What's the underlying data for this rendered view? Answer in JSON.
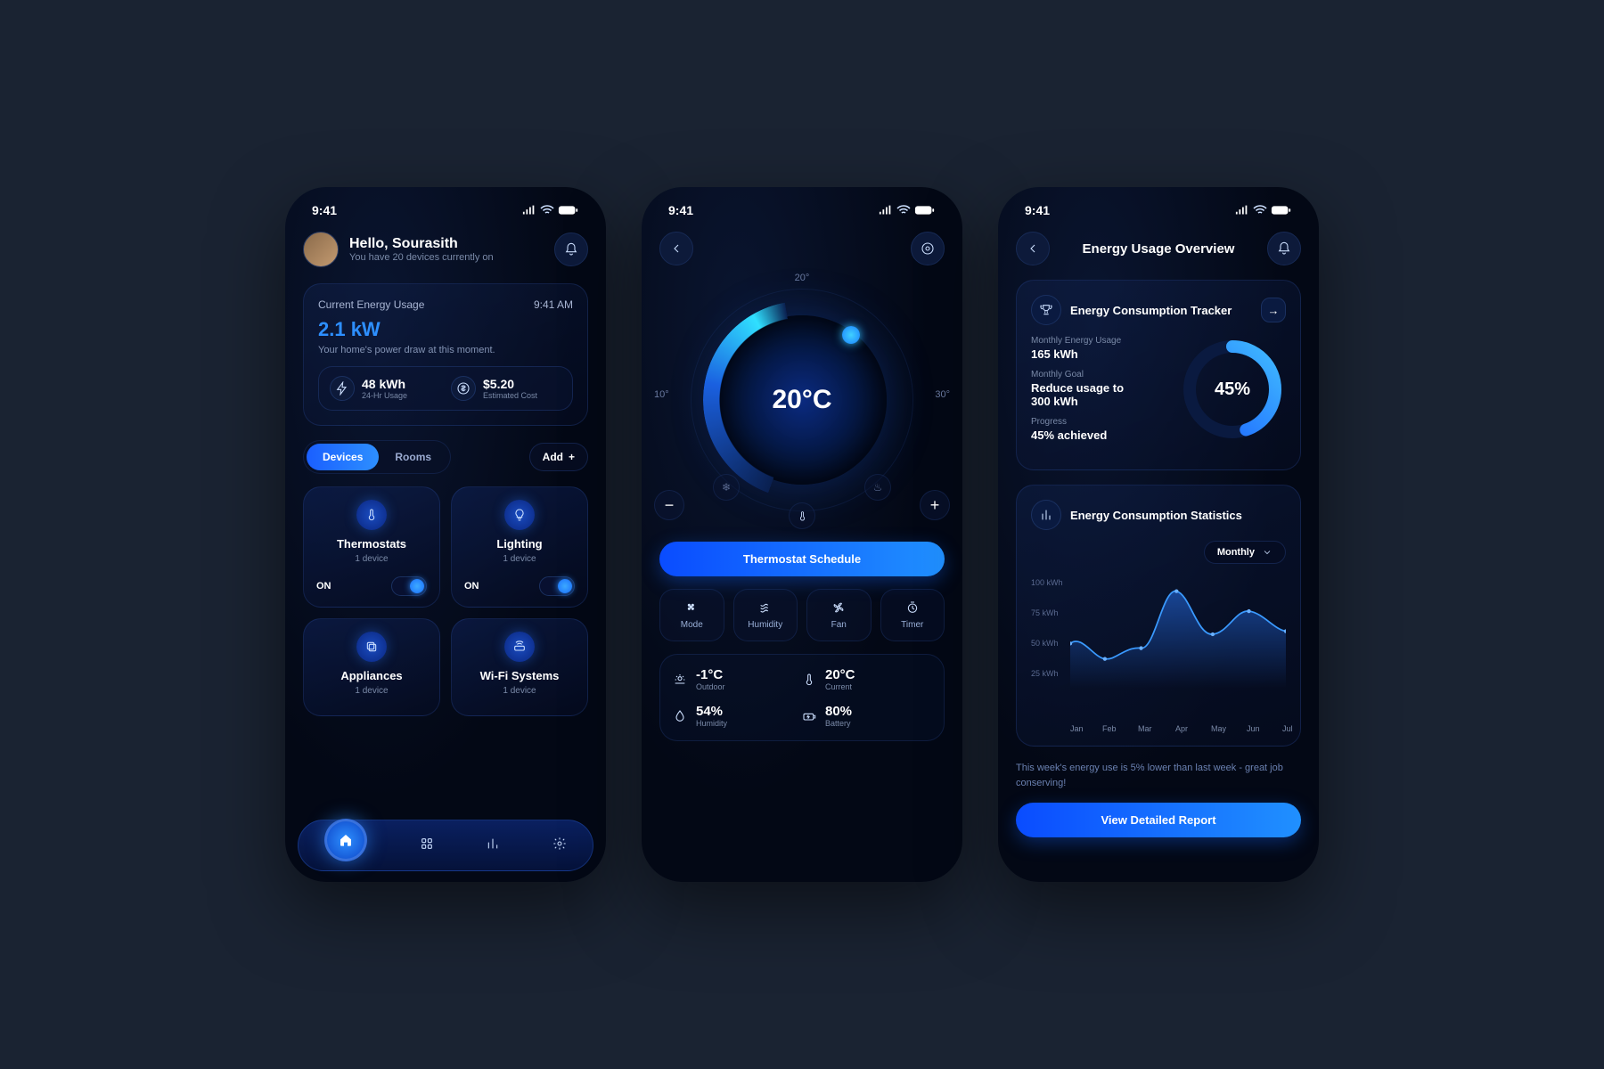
{
  "status": {
    "time": "9:41"
  },
  "s1": {
    "greeting": "Hello, Sourasith",
    "subtitle": "You have 20 devices currently on",
    "usage_title": "Current Energy Usage",
    "usage_time": "9:41 AM",
    "kw": "2.1 kW",
    "kw_desc": "Your home's power draw at this moment.",
    "stat24_value": "48 kWh",
    "stat24_label": "24-Hr Usage",
    "cost_value": "$5.20",
    "cost_label": "Estimated Cost",
    "tab_devices": "Devices",
    "tab_rooms": "Rooms",
    "add": "Add",
    "devices": [
      {
        "name": "Thermostats",
        "count": "1 device",
        "state": "ON",
        "on": true
      },
      {
        "name": "Lighting",
        "count": "1 device",
        "state": "ON",
        "on": true
      },
      {
        "name": "Appliances",
        "count": "1 device",
        "state": "",
        "on": false
      },
      {
        "name": "Wi-Fi Systems",
        "count": "1 device",
        "state": "",
        "on": false
      }
    ]
  },
  "s2": {
    "arc_top": "20°",
    "arc_left": "10°",
    "arc_right": "30°",
    "temp": "20°C",
    "schedule_btn": "Thermostat Schedule",
    "controls": [
      {
        "label": "Mode"
      },
      {
        "label": "Humidity"
      },
      {
        "label": "Fan"
      },
      {
        "label": "Timer"
      }
    ],
    "stats": {
      "outdoor_value": "-1°C",
      "outdoor_label": "Outdoor",
      "current_value": "20°C",
      "current_label": "Current",
      "humidity_value": "54%",
      "humidity_label": "Humidity",
      "battery_value": "80%",
      "battery_label": "Battery"
    }
  },
  "s3": {
    "title": "Energy Usage Overview",
    "tracker_title": "Energy Consumption Tracker",
    "monthly_label": "Monthly Energy Usage",
    "monthly_value": "165 kWh",
    "goal_label": "Monthly Goal",
    "goal_value": "Reduce usage to 300 kWh",
    "progress_label": "Progress",
    "progress_value": "45% achieved",
    "ring_pct": "45%",
    "stats_title": "Energy Consumption Statistics",
    "range": "Monthly",
    "yticks": [
      "100 kWh",
      "75 kWh",
      "50 kWh",
      "25 kWh"
    ],
    "xticks": [
      "Jan",
      "Feb",
      "Mar",
      "Apr",
      "May",
      "Jun",
      "Jul"
    ],
    "note": "This week's energy use is 5% lower than last week - great job conserving!",
    "report_btn": "View Detailed Report"
  },
  "chart_data": {
    "type": "line",
    "title": "Energy Consumption Statistics",
    "xlabel": "",
    "ylabel": "kWh",
    "categories": [
      "Jan",
      "Feb",
      "Mar",
      "Apr",
      "May",
      "Jun",
      "Jul"
    ],
    "values": [
      52,
      40,
      48,
      90,
      58,
      75,
      60
    ],
    "ylim": [
      25,
      100
    ]
  }
}
